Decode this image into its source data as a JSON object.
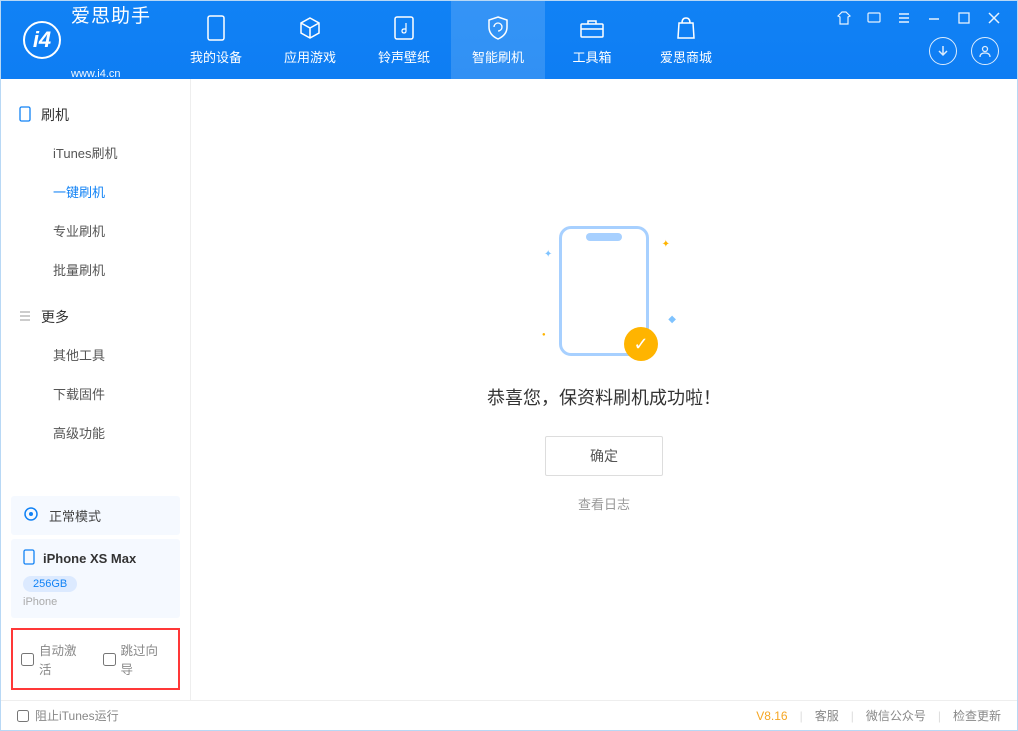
{
  "app": {
    "name": "爱思助手",
    "url": "www.i4.cn"
  },
  "nav": {
    "tabs": [
      {
        "label": "我的设备"
      },
      {
        "label": "应用游戏"
      },
      {
        "label": "铃声壁纸"
      },
      {
        "label": "智能刷机"
      },
      {
        "label": "工具箱"
      },
      {
        "label": "爱思商城"
      }
    ]
  },
  "sidebar": {
    "section1": {
      "title": "刷机",
      "items": [
        {
          "label": "iTunes刷机"
        },
        {
          "label": "一键刷机"
        },
        {
          "label": "专业刷机"
        },
        {
          "label": "批量刷机"
        }
      ]
    },
    "section2": {
      "title": "更多",
      "items": [
        {
          "label": "其他工具"
        },
        {
          "label": "下载固件"
        },
        {
          "label": "高级功能"
        }
      ]
    },
    "mode": "正常模式",
    "device": {
      "name": "iPhone XS Max",
      "capacity": "256GB",
      "type": "iPhone"
    },
    "checks": {
      "auto_activate": "自动激活",
      "skip_guide": "跳过向导"
    }
  },
  "main": {
    "success_text": "恭喜您，保资料刷机成功啦！",
    "ok_button": "确定",
    "view_log": "查看日志"
  },
  "footer": {
    "block_itunes": "阻止iTunes运行",
    "version": "V8.16",
    "links": {
      "service": "客服",
      "wechat": "微信公众号",
      "update": "检查更新"
    }
  }
}
